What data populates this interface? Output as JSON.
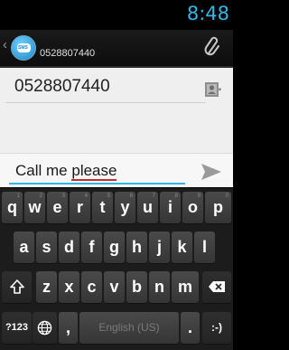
{
  "status_bar": {
    "time": "8:48"
  },
  "action_bar": {
    "app_icon_text": "SMS",
    "contact_number": "0528807440"
  },
  "recipient": {
    "value": "0528807440"
  },
  "compose": {
    "text_plain": "Call me ",
    "text_misspelled": "please"
  },
  "keyboard": {
    "row1": [
      {
        "label": "q",
        "hint": "1"
      },
      {
        "label": "w",
        "hint": "2"
      },
      {
        "label": "e",
        "hint": "3"
      },
      {
        "label": "r",
        "hint": "4"
      },
      {
        "label": "t",
        "hint": "5"
      },
      {
        "label": "y",
        "hint": "6"
      },
      {
        "label": "u",
        "hint": "7"
      },
      {
        "label": "i",
        "hint": "8"
      },
      {
        "label": "o",
        "hint": "9"
      },
      {
        "label": "p",
        "hint": "0"
      }
    ],
    "row2": [
      "a",
      "s",
      "d",
      "f",
      "g",
      "h",
      "j",
      "k",
      "l"
    ],
    "row3": [
      "z",
      "x",
      "c",
      "v",
      "b",
      "n",
      "m"
    ],
    "row4": {
      "symbols_label": "?123",
      "comma": ",",
      "space_label": "English (US)",
      "period": ".",
      "smiley": ":-)"
    },
    "icons": {
      "shift": "shift-icon",
      "delete": "backspace-icon",
      "globe": "globe-icon"
    }
  }
}
